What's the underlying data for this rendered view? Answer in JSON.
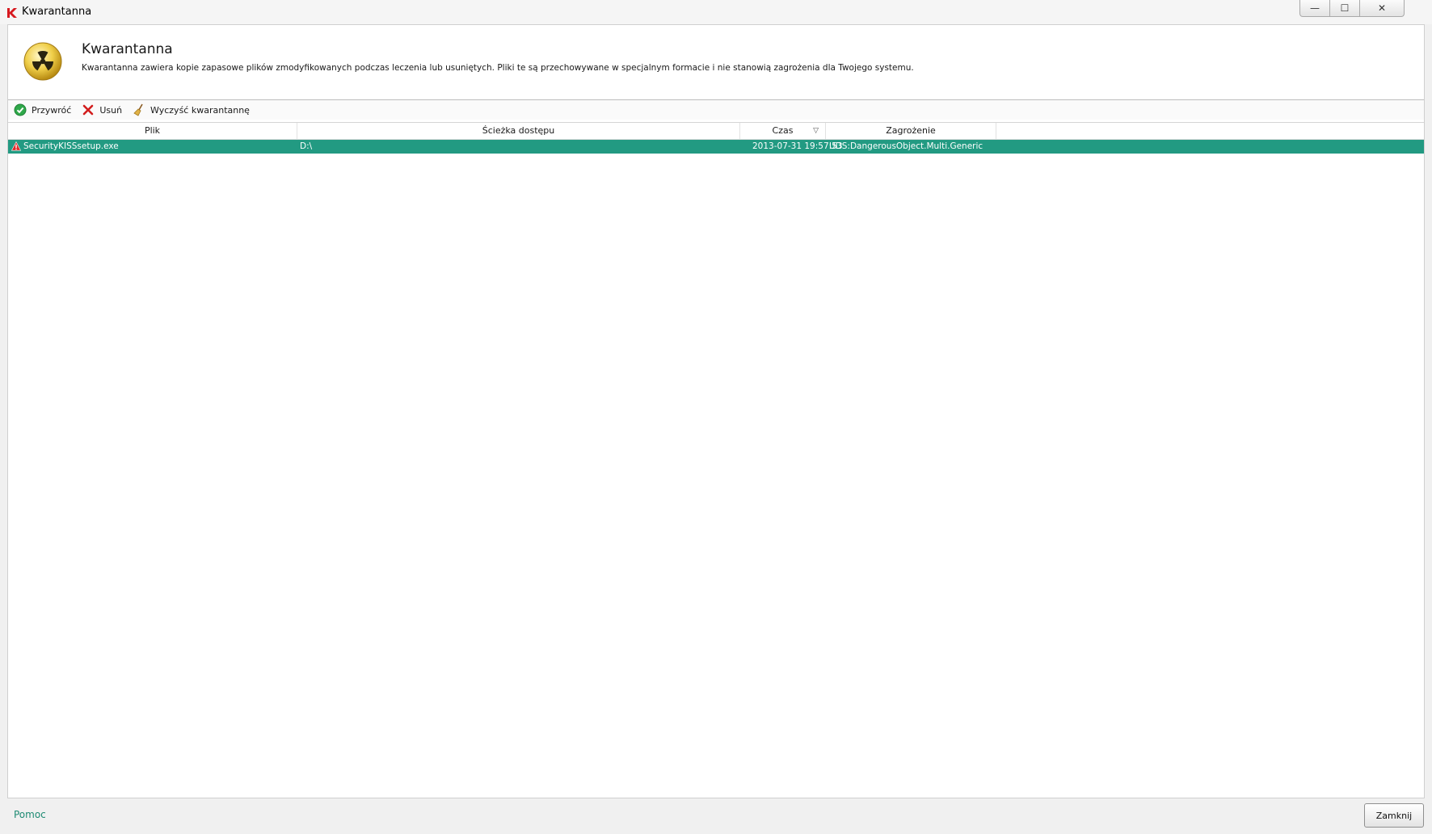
{
  "window": {
    "title": "Kwarantanna",
    "controls": {
      "minimize": "—",
      "maximize": "☐",
      "close": "✕"
    }
  },
  "header": {
    "title": "Kwarantanna",
    "description": "Kwarantanna zawiera kopie zapasowe plików zmodyfikowanych podczas leczenia lub usuniętych. Pliki te są przechowywane w specjalnym formacie i nie stanowią zagrożenia dla Twojego systemu.",
    "icon": "radiation-icon"
  },
  "toolbar": {
    "restore_label": "Przywróć",
    "delete_label": "Usuń",
    "clear_label": "Wyczyść kwarantannę"
  },
  "table": {
    "columns": {
      "file": "Plik",
      "path": "Ścieżka dostępu",
      "time": "Czas",
      "threat": "Zagrożenie"
    },
    "sort_indicator": "▽",
    "rows": [
      {
        "file": "SecurityKISSsetup.exe",
        "path": "D:\\",
        "time": "2013-07-31 19:57:53",
        "threat": "UDS:DangerousObject.Multi.Generic"
      }
    ]
  },
  "footer": {
    "help_link": "Pomoc",
    "close_button": "Zamknij"
  },
  "colors": {
    "selection": "#229a82",
    "link": "#1d8a73",
    "brand_red": "#d7191f"
  }
}
